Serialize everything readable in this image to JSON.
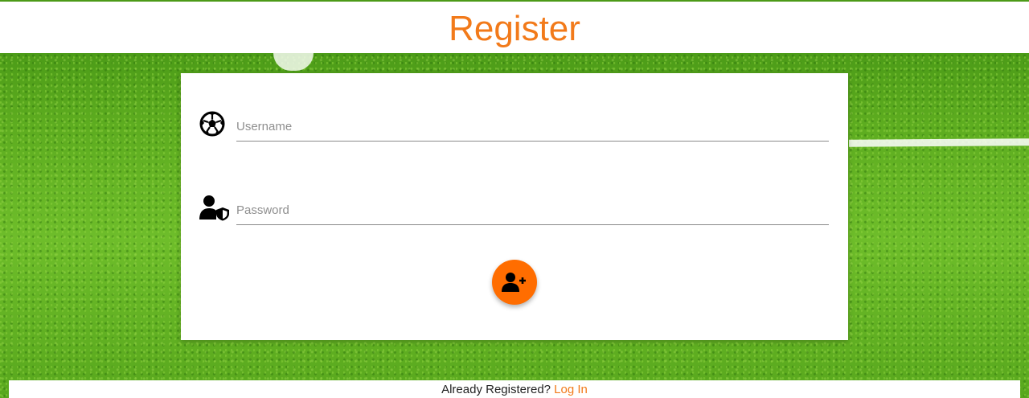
{
  "header": {
    "title": "Register"
  },
  "form": {
    "username": {
      "placeholder": "Username",
      "value": "",
      "icon": "soccer-ball-icon"
    },
    "password": {
      "placeholder": "Password",
      "value": "",
      "icon": "user-shield-icon"
    },
    "submit": {
      "icon": "user-plus-icon"
    }
  },
  "footer": {
    "prompt": "Already Registered? ",
    "link_label": "Log In"
  },
  "colors": {
    "accent": "#f27a1a",
    "button": "#ff6d00",
    "background": "#5aa61c"
  }
}
